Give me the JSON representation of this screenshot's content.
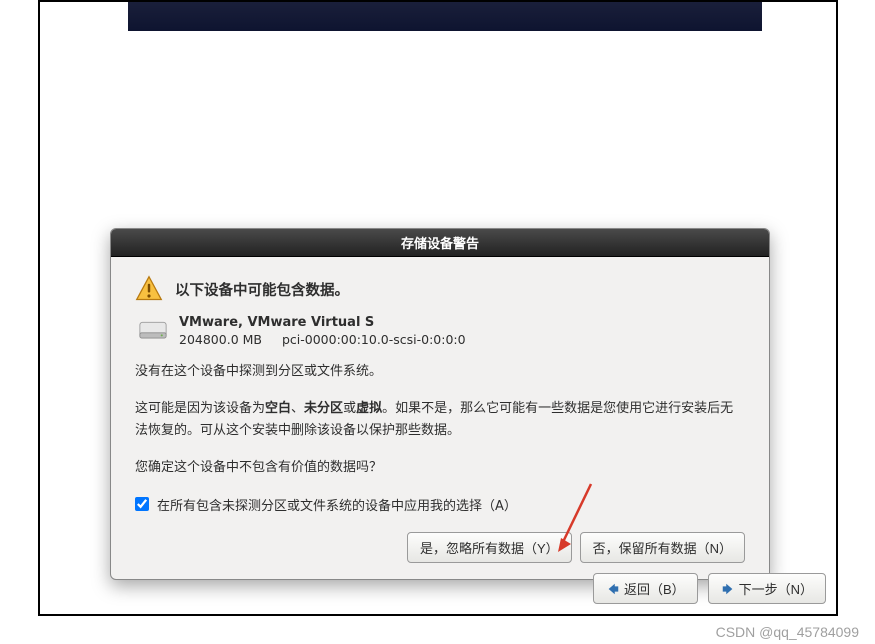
{
  "dialog": {
    "title": "存储设备警告",
    "header": "以下设备中可能包含数据。",
    "device": {
      "name": "VMware, VMware Virtual S",
      "size": "204800.0 MB",
      "path": "pci-0000:00:10.0-scsi-0:0:0:0"
    },
    "para1": "没有在这个设备中探测到分区或文件系统。",
    "para2_pre": "这可能是因为该设备为",
    "para2_b1": "空白",
    "para2_sep1": "、",
    "para2_b2": "未分区",
    "para2_sep2": "或",
    "para2_b3": "虚拟",
    "para2_post": "。如果不是，那么它可能有一些数据是您使用它进行安装后无法恢复的。可从这个安装中删除该设备以保护那些数据。",
    "para3": "您确定这个设备中不包含有价值的数据吗？",
    "checkbox_label": "在所有包含未探测分区或文件系统的设备中应用我的选择（A）",
    "checkbox_checked": true,
    "btn_yes": "是，忽略所有数据（Y）",
    "btn_no": "否，保留所有数据（N）"
  },
  "wizard": {
    "back": "返回（B）",
    "next": "下一步（N）"
  },
  "watermark": "CSDN @qq_45784099",
  "colors": {
    "arrow_blue": "#2f6fb0",
    "red": "#d73a2a"
  }
}
